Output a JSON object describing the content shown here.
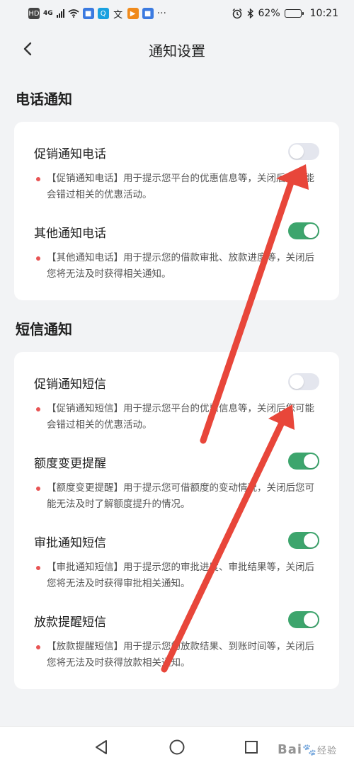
{
  "status_bar": {
    "network": "4G",
    "battery_percent": "62%",
    "battery_level": 0.62,
    "time": "10:21"
  },
  "header": {
    "title": "通知设置"
  },
  "sections": [
    {
      "title": "电话通知",
      "items": [
        {
          "label": "促销通知电话",
          "enabled": false,
          "description": "【促销通知电话】用于提示您平台的优惠信息等，关闭后您可能会错过相关的优惠活动。"
        },
        {
          "label": "其他通知电话",
          "enabled": true,
          "description": "【其他通知电话】用于提示您的借款审批、放款进度等，关闭后您将无法及时获得相关通知。"
        }
      ]
    },
    {
      "title": "短信通知",
      "items": [
        {
          "label": "促销通知短信",
          "enabled": false,
          "description": "【促销通知短信】用于提示您平台的优惠信息等，关闭后您可能会错过相关的优惠活动。"
        },
        {
          "label": "额度变更提醒",
          "enabled": true,
          "description": "【额度变更提醒】用于提示您可借额度的变动情况，关闭后您可能无法及时了解额度提升的情况。"
        },
        {
          "label": "审批通知短信",
          "enabled": true,
          "description": "【审批通知短信】用于提示您的审批进度、审批结果等，关闭后您将无法及时获得审批相关通知。"
        },
        {
          "label": "放款提醒短信",
          "enabled": true,
          "description": "【放款提醒短信】用于提示您的放款结果、到账时间等，关闭后您将无法及时获得放款相关通知。"
        }
      ]
    }
  ],
  "watermark": {
    "brand": "Bai",
    "suffix": "经验"
  },
  "colors": {
    "toggle_on": "#3da56d",
    "toggle_off": "#e4e6ee",
    "bullet": "#e85454",
    "annotation_arrow": "#e8463a"
  }
}
